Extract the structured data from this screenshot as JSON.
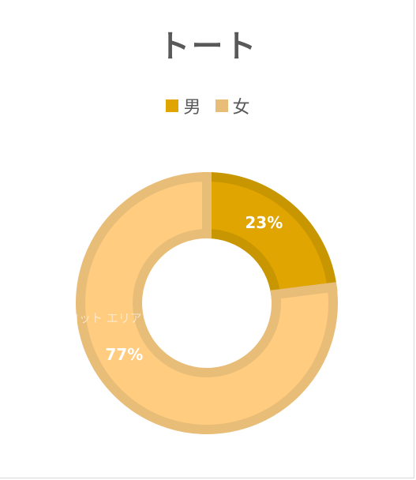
{
  "chart_data": {
    "type": "pie",
    "title": "トート",
    "categories": [
      "男",
      "女"
    ],
    "values": [
      23,
      77
    ],
    "value_format": "percent",
    "colors": [
      "#E0A500",
      "#FFCC80"
    ],
    "border_colors": [
      "#C89600",
      "#E8BD78"
    ],
    "legend_position": "top",
    "donut": true
  },
  "plot_area_label": "プロット エリア",
  "label_color": "#ffffff"
}
